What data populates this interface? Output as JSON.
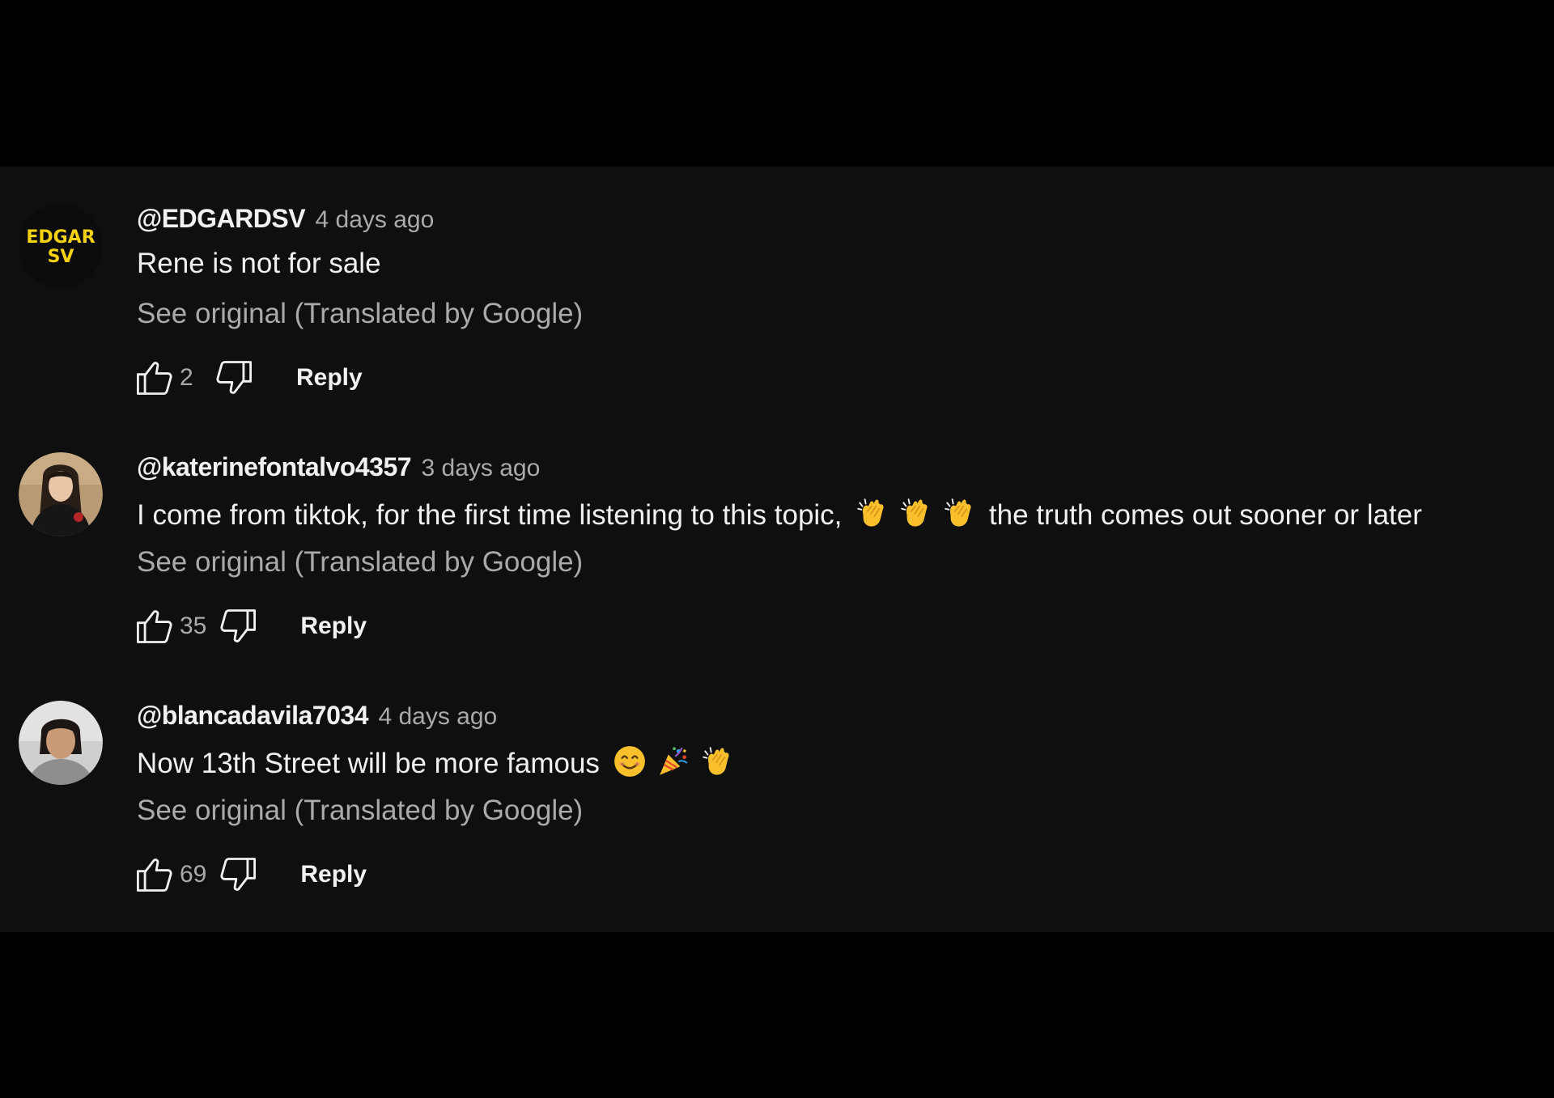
{
  "comments": [
    {
      "author": "@EDGARDSV",
      "timestamp": "4 days ago",
      "text": "Rene is not for sale",
      "text_after_emoji": "",
      "emojis": [],
      "translation_link": "See original (Translated by Google)",
      "likes": "2",
      "reply_label": "Reply",
      "avatar": {
        "type": "logo",
        "line1": "EDGAR",
        "line2": "SV",
        "text_color": "#f5d20f",
        "bg": "#0b0b0b"
      }
    },
    {
      "author": "@katerinefontalvo4357",
      "timestamp": "3 days ago",
      "text": "I come from tiktok, for the first time listening to this topic,",
      "emojis": [
        "clapping-hands",
        "clapping-hands",
        "clapping-hands"
      ],
      "text_after_emoji": "the truth comes out sooner or later",
      "translation_link": "See original (Translated by Google)",
      "likes": "35",
      "reply_label": "Reply",
      "avatar": {
        "type": "photo",
        "bg": "#b89a74"
      }
    },
    {
      "author": "@blancadavila7034",
      "timestamp": "4 days ago",
      "text": "Now 13th Street will be more famous",
      "emojis": [
        "smiling-face",
        "party-popper",
        "clapping-hands"
      ],
      "text_after_emoji": "",
      "translation_link": "See original (Translated by Google)",
      "likes": "69",
      "reply_label": "Reply",
      "avatar": {
        "type": "photo",
        "bg": "#c9c9c9"
      }
    }
  ],
  "colors": {
    "background": "#000000",
    "panel": "#0f0f0f",
    "primary_text": "#f1f1f1",
    "secondary_text": "#aaaaaa",
    "emoji_yellow": "#f9c02b"
  }
}
